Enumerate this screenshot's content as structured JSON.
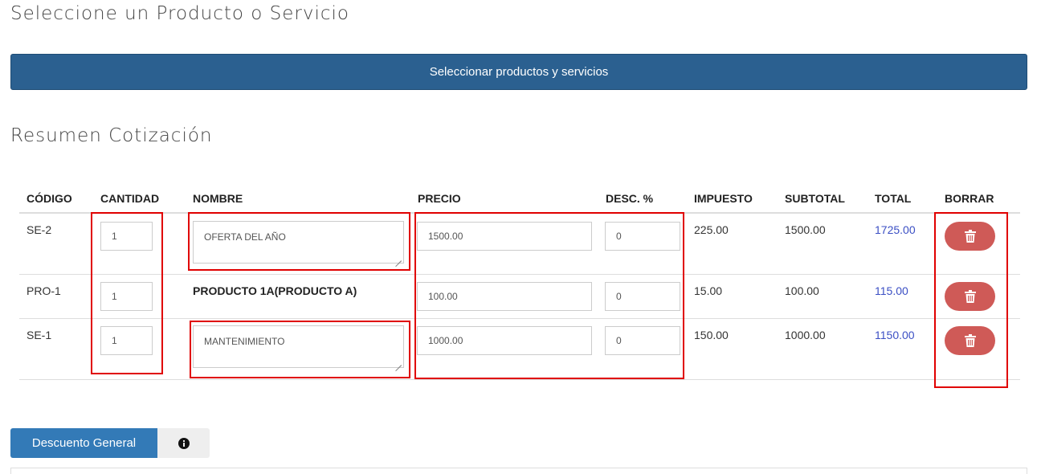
{
  "header": {
    "select_title": "Seleccione un Producto o Servicio",
    "select_button": "Seleccionar productos y servicios",
    "summary_title": "Resumen Cotización"
  },
  "table": {
    "columns": [
      "CÓDIGO",
      "CANTIDAD",
      "NOMBRE",
      "PRECIO",
      "DESC. %",
      "IMPUESTO",
      "SUBTOTAL",
      "TOTAL",
      "BORRAR"
    ],
    "rows": [
      {
        "codigo": "SE-2",
        "cantidad": "1",
        "nombre": "OFERTA DEL AÑO",
        "nombre_editable": true,
        "precio": "1500.00",
        "desc": "0",
        "impuesto": "225.00",
        "subtotal": "1500.00",
        "total": "1725.00"
      },
      {
        "codigo": "PRO-1",
        "cantidad": "1",
        "nombre": "PRODUCTO 1A(PRODUCTO A)",
        "nombre_editable": false,
        "precio": "100.00",
        "desc": "0",
        "impuesto": "15.00",
        "subtotal": "100.00",
        "total": "115.00"
      },
      {
        "codigo": "SE-1",
        "cantidad": "1",
        "nombre": "MANTENIMIENTO",
        "nombre_editable": true,
        "precio": "1000.00",
        "desc": "0",
        "impuesto": "150.00",
        "subtotal": "1000.00",
        "total": "1150.00"
      }
    ]
  },
  "footer": {
    "discount_button": "Descuento General",
    "info_icon": "info-circle-icon"
  },
  "colors": {
    "primary_dark": "#2b6090",
    "primary": "#337ab7",
    "danger": "#cf5a57",
    "highlight": "#e00000",
    "link": "#3b4fc4"
  }
}
